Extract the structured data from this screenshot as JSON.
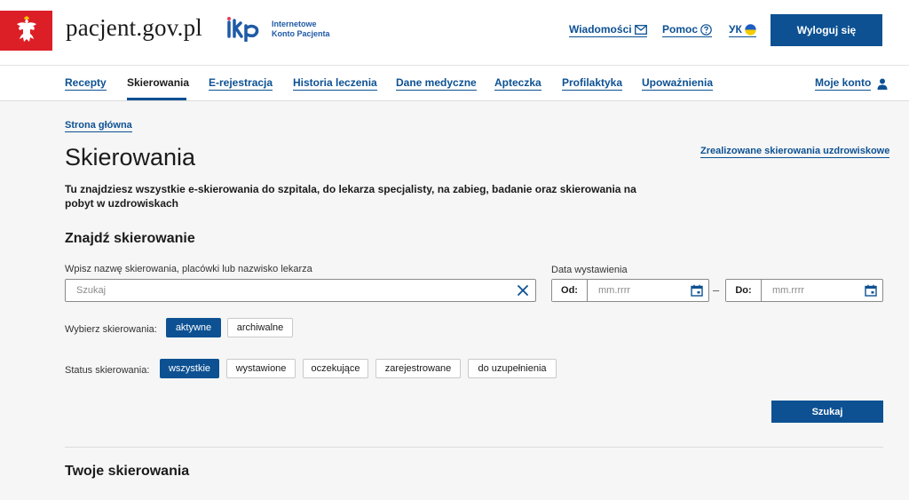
{
  "header": {
    "site_name": "pacjent.gov.pl",
    "ikp_line1": "Internetowe",
    "ikp_line2": "Konto Pacjenta",
    "messages_label": "Wiadomości",
    "help_label": "Pomoc",
    "lang_label": "УК",
    "logout_label": "Wyloguj się"
  },
  "nav": {
    "items": [
      {
        "label": "Recepty"
      },
      {
        "label": "Skierowania"
      },
      {
        "label": "E-rejestracja"
      },
      {
        "label": "Historia leczenia"
      },
      {
        "label": "Dane medyczne"
      },
      {
        "label": "Apteczka"
      },
      {
        "label": "Profilaktyka"
      },
      {
        "label": "Upoważnienia"
      }
    ],
    "account_label": "Moje konto"
  },
  "main": {
    "breadcrumb": "Strona główna",
    "title": "Skierowania",
    "spa_link": "Zrealizowane skierowania uzdrowiskowe",
    "intro": "Tu znajdziesz wszystkie e-skierowania do szpitala, do lekarza specjalisty, na zabieg, badanie oraz skierowania na pobyt w uzdrowiskach",
    "search_section_title": "Znajdź skierowanie",
    "search_label": "Wpisz nazwę skierowania, placówki lub nazwisko lekarza",
    "search_placeholder": "Szukaj",
    "date_label": "Data wystawienia",
    "date_from_prefix": "Od:",
    "date_to_prefix": "Do:",
    "date_placeholder": "mm.rrrr",
    "date_separator": "–",
    "type_label": "Wybierz skierowania:",
    "type_options": [
      "aktywne",
      "archiwalne"
    ],
    "status_label": "Status skierowania:",
    "status_options": [
      "wszystkie",
      "wystawione",
      "oczekujące",
      "zarejestrowane",
      "do uzupełnienia"
    ],
    "search_button": "Szukaj",
    "results_title": "Twoje skierowania"
  },
  "colors": {
    "brand_blue": "#0d5193",
    "emblem_red": "#dc1f26"
  }
}
